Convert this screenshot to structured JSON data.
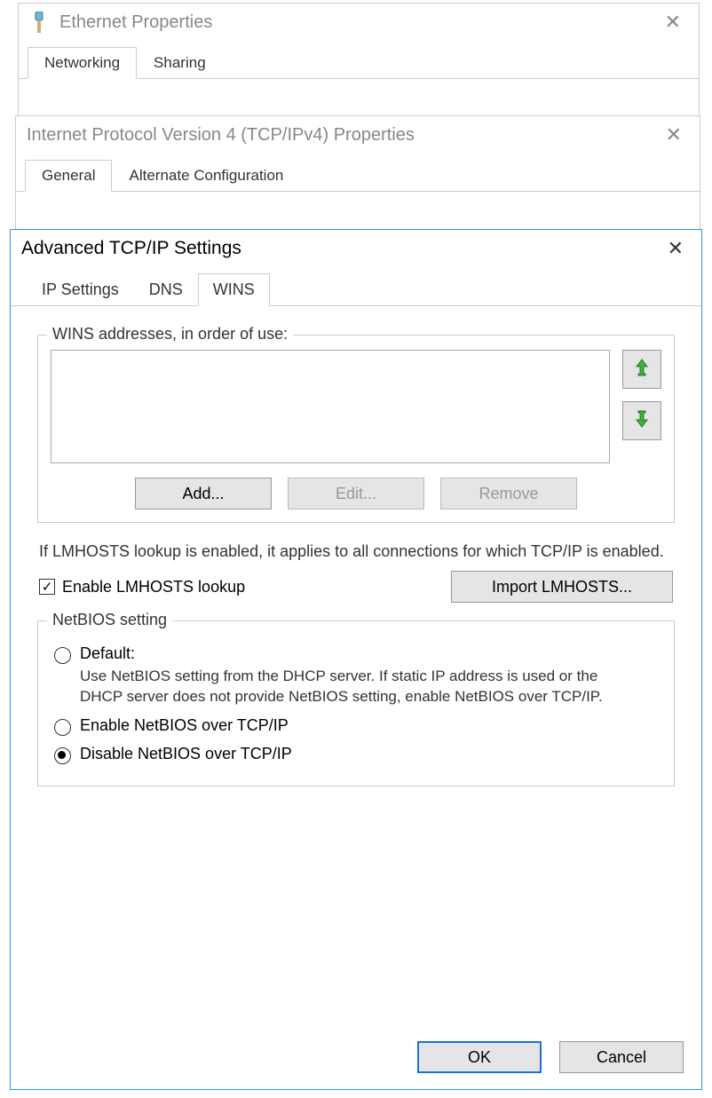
{
  "win1": {
    "title": "Ethernet Properties",
    "tabs": [
      "Networking",
      "Sharing"
    ],
    "active_tab": 0
  },
  "win2": {
    "title": "Internet Protocol Version 4 (TCP/IPv4) Properties",
    "tabs": [
      "General",
      "Alternate Configuration"
    ],
    "active_tab": 0
  },
  "win3": {
    "title": "Advanced TCP/IP Settings",
    "tabs": [
      "IP Settings",
      "DNS",
      "WINS"
    ],
    "active_tab": 2,
    "wins_group_label": "WINS addresses, in order of use:",
    "buttons": {
      "add": "Add...",
      "edit": "Edit...",
      "remove": "Remove"
    },
    "lmhosts_text": "If LMHOSTS lookup is enabled, it applies to all connections for which TCP/IP is enabled.",
    "enable_lmhosts_label": "Enable LMHOSTS lookup",
    "enable_lmhosts_checked": true,
    "import_lmhosts": "Import LMHOSTS...",
    "netbios": {
      "legend": "NetBIOS setting",
      "selected": 2,
      "options": [
        {
          "label": "Default:",
          "desc": "Use NetBIOS setting from the DHCP server. If static IP address is used or the DHCP server does not provide NetBIOS setting, enable NetBIOS over TCP/IP."
        },
        {
          "label": "Enable NetBIOS over TCP/IP",
          "desc": ""
        },
        {
          "label": "Disable NetBIOS over TCP/IP",
          "desc": ""
        }
      ]
    },
    "ok": "OK",
    "cancel": "Cancel"
  }
}
